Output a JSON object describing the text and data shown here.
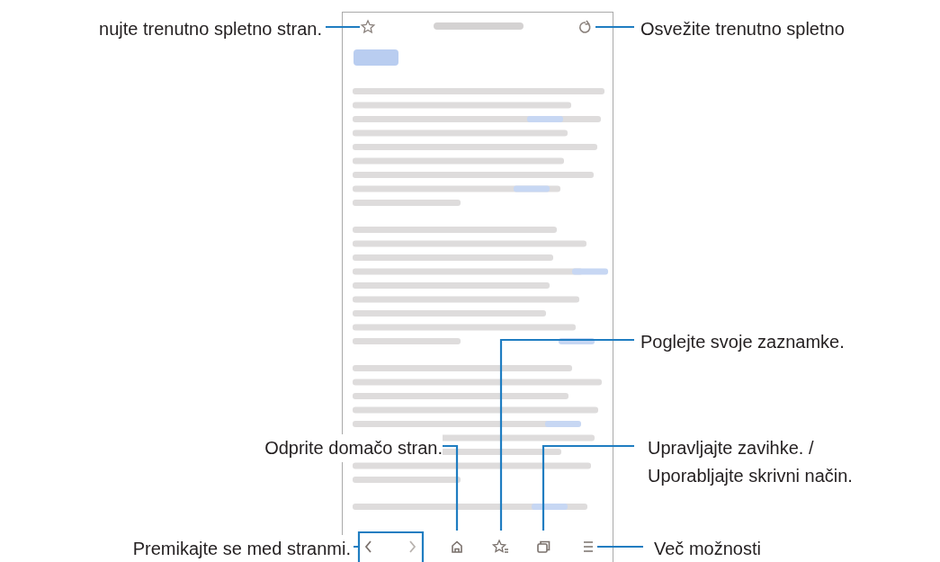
{
  "callouts": [
    {
      "lines": [
        "nujte trenutno spletno stran."
      ]
    },
    {
      "lines": [
        "Osvežite trenutno spletno"
      ]
    },
    {
      "lines": [
        "Poglejte svoje zaznamke."
      ]
    },
    {
      "lines": [
        "Odprite domačo stran."
      ]
    },
    {
      "lines": [
        "Upravljajte zavihke. /",
        "Uporabljajte skrivni način."
      ]
    },
    {
      "lines": [
        "Premikajte se med stranmi."
      ]
    },
    {
      "lines": [
        "Več možnosti"
      ]
    }
  ]
}
